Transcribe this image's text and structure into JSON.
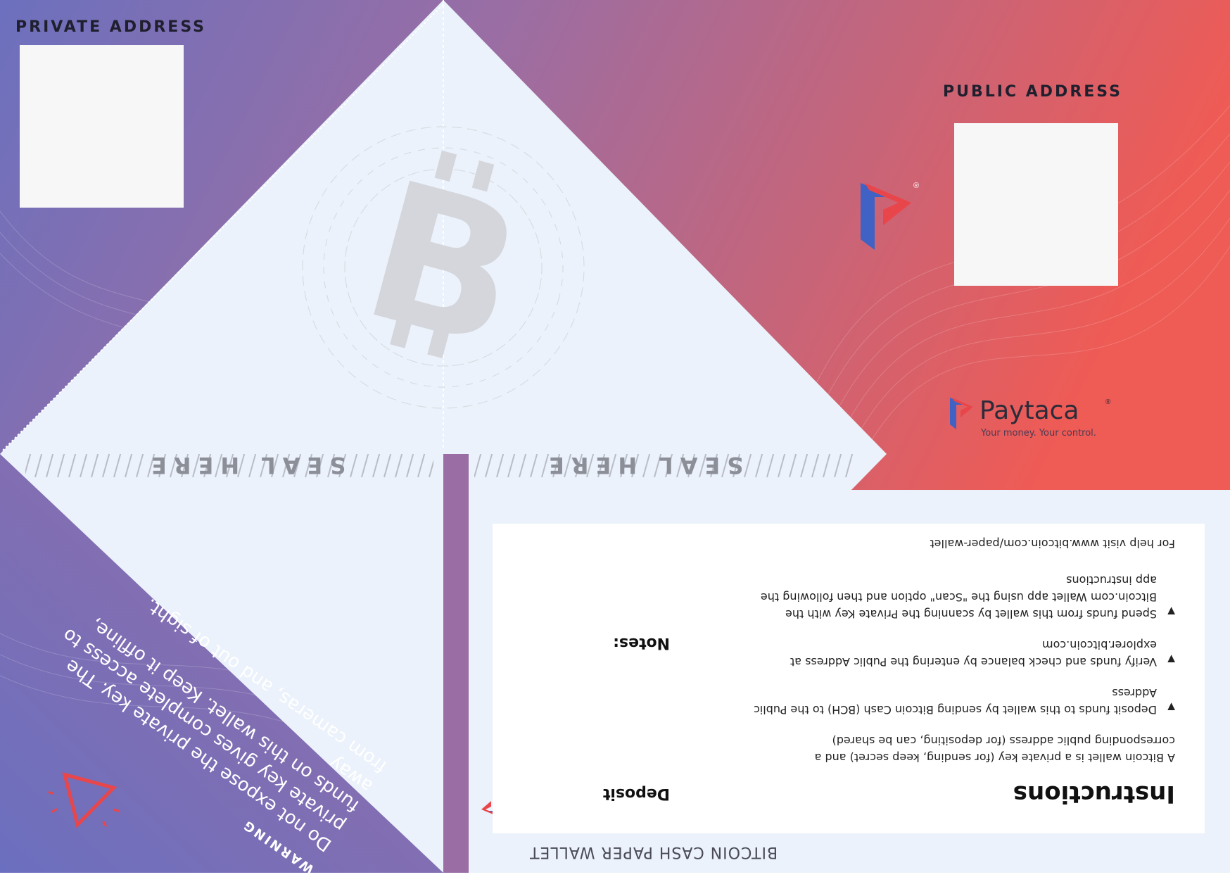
{
  "wallet": {
    "title": "BITCOIN CASH PAPER WALLET",
    "private_address_label": "PRIVATE ADDRESS",
    "public_address_label": "PUBLIC ADDRESS",
    "seal_label": "SEAL HERE"
  },
  "brand": {
    "name": "Paytaca",
    "registered": "®",
    "tagline": "Your money. Your control."
  },
  "instructions": {
    "heading": "Instructions",
    "intro_lines": [
      "A  Bitcoin wallet is a private key (for sending, keep secret) and a",
      "corresponding public address (for depositing, can be shared)"
    ],
    "steps": [
      {
        "lines": [
          "Deposit funds to this wallet by sending Bitcoin Cash (BCH) to the Public",
          "Address"
        ]
      },
      {
        "lines": [
          "Verify funds and check balance by entering the Public Address at",
          "explorer.bitcoin.com"
        ]
      },
      {
        "lines": [
          "Spend funds from this wallet by scanning the Private Key with the",
          "Bitcoin.com Wallet app using the \"Scan\" option and then following the",
          "app instructions"
        ]
      }
    ],
    "help": "For help visit www.bitcoin.com/paper-wallet",
    "deposit_label": "Deposit",
    "notes_label": "Notes:"
  },
  "warning": {
    "title": "WARNING",
    "lines": [
      "Do not expose the private key. The",
      "private key gives complete access to",
      "funds on this wallet. Keep it offline, away",
      "from cameras, and out of sight."
    ]
  },
  "colors": {
    "purple": "#6f73c0",
    "violet": "#9a6fa3",
    "coral": "#ee5b55",
    "panel": "#ebf2fb",
    "accent_red": "#e8464a",
    "accent_blue": "#3f62c4"
  },
  "icons": [
    "paytaca-logo-icon",
    "bitcoin-watermark-icon",
    "warning-triangle-icon",
    "bullet-arrow-icon"
  ]
}
